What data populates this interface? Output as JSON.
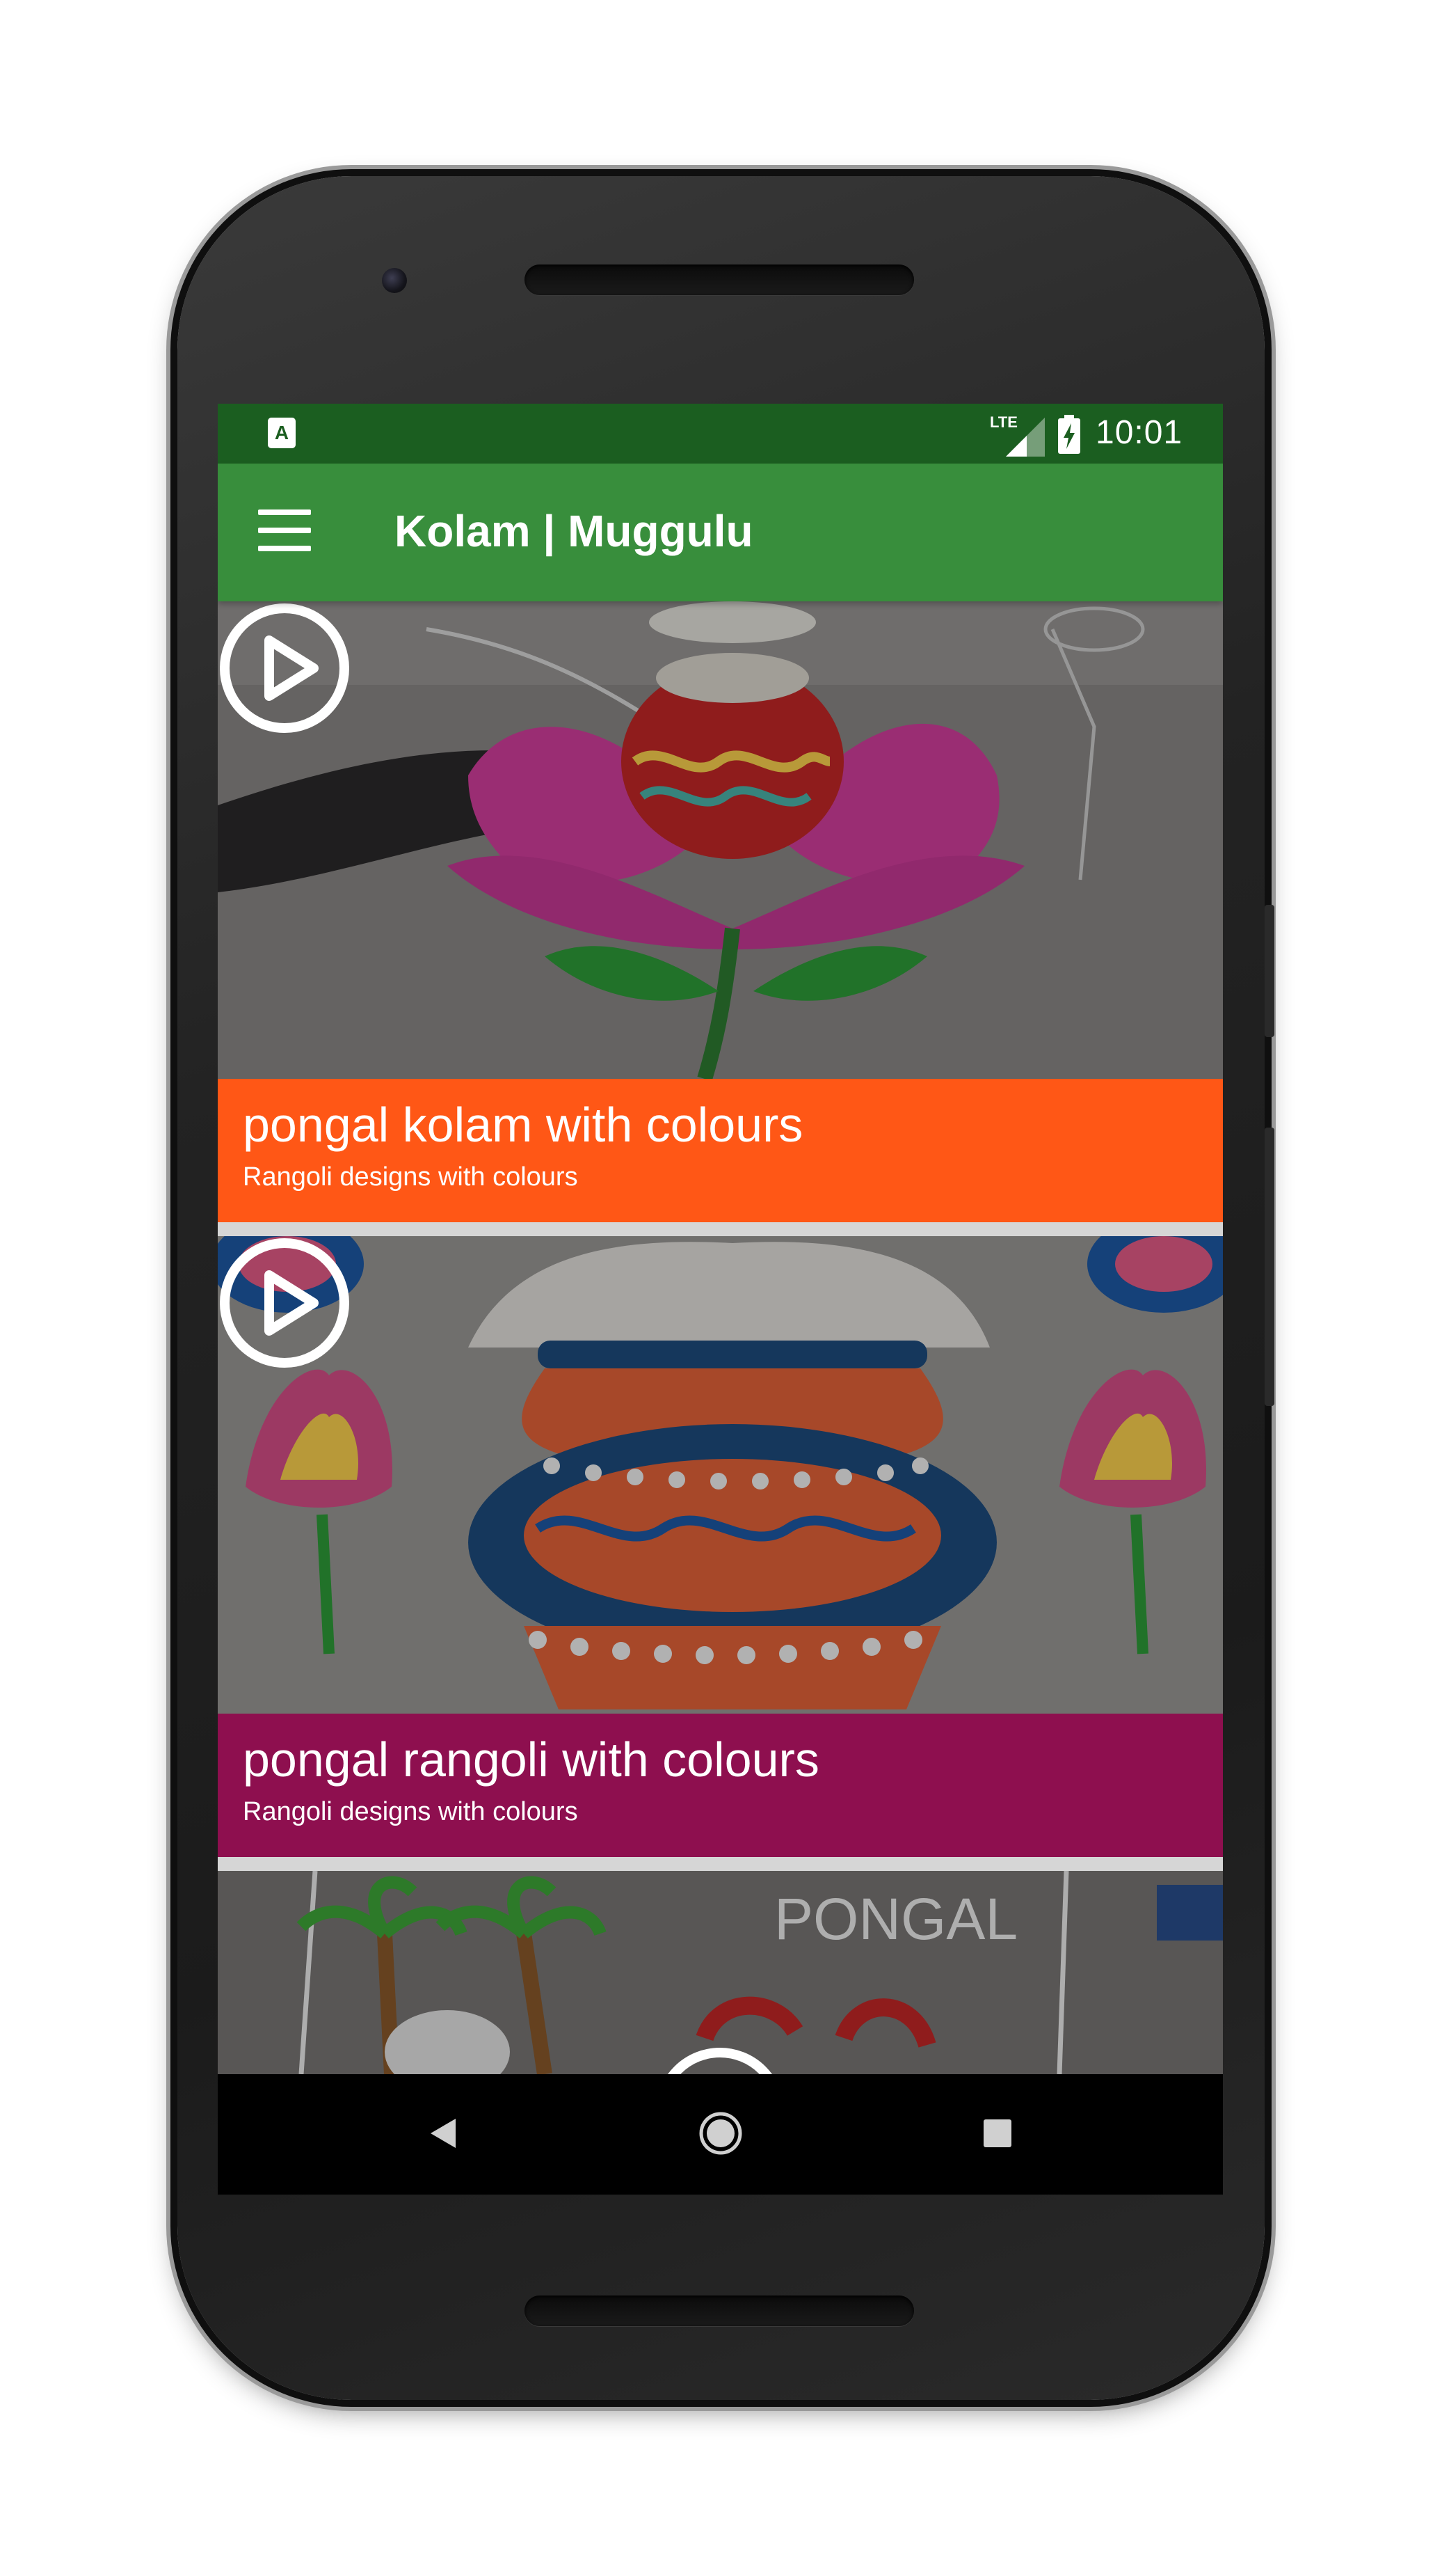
{
  "status_bar": {
    "notification_icon": "A",
    "network_label": "LTE",
    "signal_icon": "cell-signal-icon",
    "battery_icon": "battery-charging-icon",
    "time": "10:01"
  },
  "toolbar": {
    "menu_icon": "hamburger-menu-icon",
    "title": "Kolam | Muggulu"
  },
  "videos": [
    {
      "title": "pongal kolam with colours",
      "subtitle": "Rangoli designs with colours",
      "caption_color": "#ff5716"
    },
    {
      "title": "pongal rangoli with colours",
      "subtitle": "Rangoli designs with colours",
      "caption_color": "#8e0f4f"
    },
    {
      "thumbnail_text": "PONGAL"
    }
  ],
  "nav_bar": {
    "back_icon": "back-triangle-icon",
    "home_icon": "home-circle-icon",
    "recents_icon": "recents-square-icon"
  },
  "colors": {
    "status_bar": "#1b5e20",
    "toolbar": "#388e3c",
    "nav_bar": "#000000"
  }
}
